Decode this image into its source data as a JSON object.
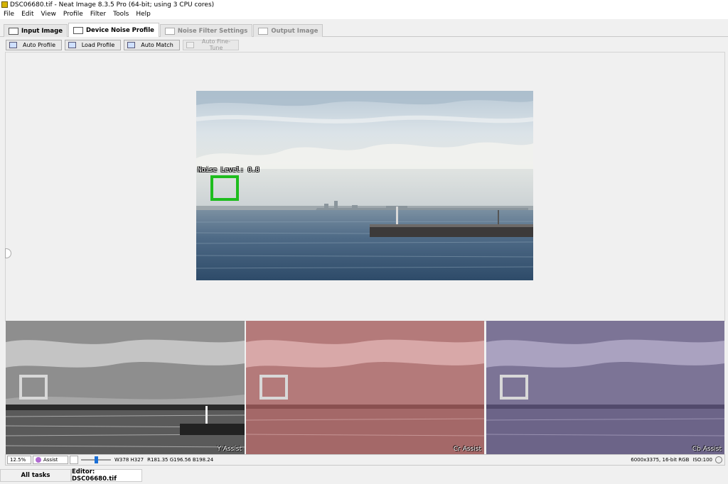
{
  "window": {
    "title": "DSC06680.tif - Neat Image 8.3.5 Pro (64-bit; using 3 CPU cores)"
  },
  "menu": [
    "File",
    "Edit",
    "View",
    "Profile",
    "Filter",
    "Tools",
    "Help"
  ],
  "tabs": [
    {
      "label": "Input Image",
      "icon": "input-image-icon",
      "state": "normal"
    },
    {
      "label": "Device Noise Profile",
      "icon": "device-noise-profile-icon",
      "state": "active"
    },
    {
      "label": "Noise Filter Settings",
      "icon": "noise-filter-settings-icon",
      "state": "disabled"
    },
    {
      "label": "Output Image",
      "icon": "output-image-icon",
      "state": "disabled"
    }
  ],
  "toolbar": {
    "auto_profile": "Auto Profile",
    "load_profile": "Load Profile",
    "auto_match": "Auto Match",
    "auto_fine_tune": "Auto Fine-Tune"
  },
  "viewer": {
    "noise_level_label": "Noise Level: 0.8"
  },
  "panels": {
    "y": "Y Assist",
    "cr": "Cr Assist",
    "cb": "Cb Assist"
  },
  "status": {
    "zoom": "12.5%",
    "mode": "Assist",
    "slider_fraction": 0.5,
    "dims": "W378   H327",
    "rgb": "R181.35 G196.56 B198.24",
    "file_info": "6000x3375, 16-bit RGB",
    "iso": "ISO:100"
  },
  "bottom_tabs": {
    "all_tasks": "All tasks",
    "editor": "Editor: DSC06680.tif"
  },
  "colors": {
    "noise_box": "#1ebd1e",
    "cr_tint": "#b86a6a",
    "cb_tint": "#7a6e98"
  }
}
